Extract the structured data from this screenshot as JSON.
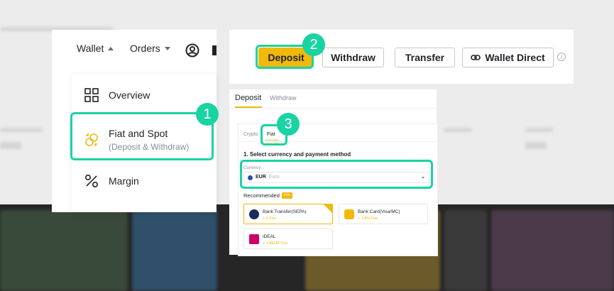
{
  "nav": {
    "wallet_label": "Wallet",
    "orders_label": "Orders",
    "account_icon": "user-circle-icon"
  },
  "menu": {
    "items": [
      {
        "label": "Overview",
        "icon": "grid-icon"
      },
      {
        "label": "Fiat and Spot",
        "sublabel": "(Deposit & Withdraw)",
        "icon": "exchange-coins-icon"
      },
      {
        "label": "Margin",
        "icon": "percent-icon"
      }
    ]
  },
  "actions": {
    "deposit": "Deposit",
    "withdraw": "Withdraw",
    "transfer": "Transfer",
    "wallet_direct": "Wallet Direct",
    "info_icon": "info-icon",
    "link_icon": "link-icon"
  },
  "deposit_panel": {
    "tabs": [
      "Deposit",
      "Withdraw"
    ],
    "subtabs": [
      "Crypto",
      "Fiat"
    ],
    "step_title": "1. Select currency and payment method",
    "currency_label": "Currency",
    "currency_code": "EUR",
    "currency_name": "Euro",
    "recommended_label": "Recommended",
    "hot_badge": "Hot",
    "methods": [
      {
        "name": "Bank Transfer(SEPA)",
        "fee": "+ 0 Fee"
      },
      {
        "name": "Bank Card(Visa/MC)",
        "fee": "+ 1.8% Fee"
      },
      {
        "name": "iDEAL",
        "fee": "+ 1.8EUR Fee"
      }
    ]
  },
  "callouts": [
    "1",
    "2",
    "3"
  ],
  "colors": {
    "accent": "#19d3a2",
    "brand": "#f0b90b",
    "text": "#1e2329",
    "muted": "#848e9c"
  }
}
